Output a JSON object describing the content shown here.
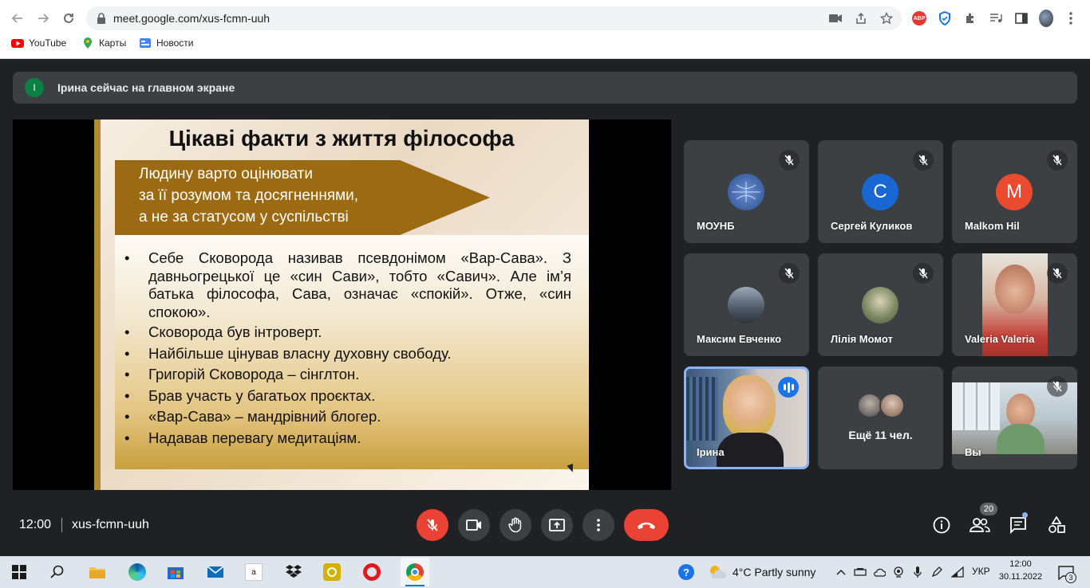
{
  "browser": {
    "url": "meet.google.com/xus-fcmn-uuh",
    "bookmarks": [
      {
        "label": "YouTube",
        "icon": "youtube-icon"
      },
      {
        "label": "Карты",
        "icon": "maps-pin-icon"
      },
      {
        "label": "Новости",
        "icon": "news-icon"
      }
    ],
    "extension_abp": "ABP"
  },
  "banner": {
    "avatar_letter": "I",
    "text": "Ірина сейчас на главном экране"
  },
  "slide": {
    "title": "Цікаві факти з життя філософа",
    "quote_lines": [
      "Людину варто оцінювати",
      "за її розумом та досягненнями,",
      "а не за статусом у суспільстві"
    ],
    "facts": [
      "Себе Сковорода називав псевдонімом «Вар-Сава». З давньогрецької це «син Сави», тобто «Савич». Але ім’я батька філософа, Сава, означає «спокій». Отже, «син спокою».",
      "Сковорода був інтроверт.",
      "Найбільше цінував власну духовну свободу.",
      "Григорій Сковорода – сінглтон.",
      "Брав участь у багатьох проєктах.",
      "«Вар-Сава» – мандрівний  блогер.",
      "Надавав перевагу медитаціям."
    ]
  },
  "participants": [
    {
      "name": "МОУНБ",
      "avatar": "logo",
      "color": "#3b6fb6"
    },
    {
      "name": "Сергей Куликов",
      "avatar": "C",
      "color": "#1967d2"
    },
    {
      "name": "Malkom Hil",
      "avatar": "M",
      "color": "#ea4b2e"
    },
    {
      "name": "Максим Евченко",
      "avatar": "photo",
      "color": "#5c6b7a"
    },
    {
      "name": "Лілія Момот",
      "avatar": "photo",
      "color": "#6b7a5c"
    },
    {
      "name": "Valeria Valeria",
      "avatar": "video",
      "color": "#c98b72"
    },
    {
      "name": "Ірина",
      "avatar": "video",
      "color": "#5b6f8a"
    },
    {
      "name": "Ещё 11 чел.",
      "avatar": "group",
      "color": "#777"
    },
    {
      "name": "Вы",
      "avatar": "video",
      "color": "#8a9aa8"
    }
  ],
  "controls": {
    "time": "12:00",
    "meeting_code": "xus-fcmn-uuh",
    "people_count": "20"
  },
  "taskbar": {
    "weather": "4°C  Partly sunny",
    "language": "УКР",
    "time": "12:00",
    "date": "30.11.2022",
    "notifications": "3"
  }
}
